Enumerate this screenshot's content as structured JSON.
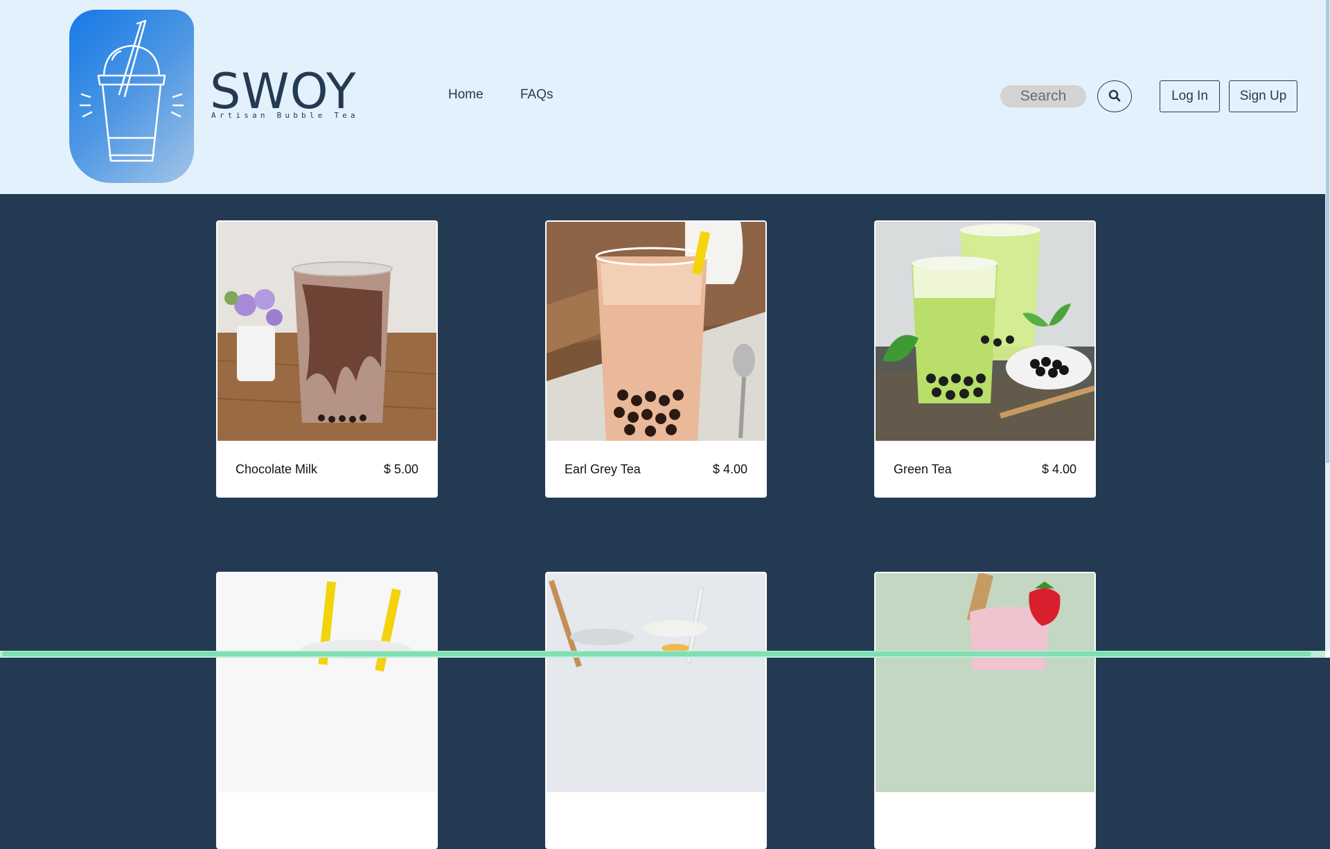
{
  "colors": {
    "header_bg": "#e3f1fc",
    "page_bg": "#243a53",
    "text_dark": "#243a53"
  },
  "brand": {
    "name": "SWOY",
    "tagline": "Artisan Bubble Tea",
    "logo_icon": "bubble-tea-cup-icon"
  },
  "nav": {
    "items": [
      {
        "label": "Home"
      },
      {
        "label": "FAQs"
      }
    ]
  },
  "search": {
    "placeholder": "Search",
    "icon": "search-icon"
  },
  "auth": {
    "login_label": "Log In",
    "signup_label": "Sign Up"
  },
  "products": [
    {
      "name": "Chocolate Milk",
      "price": "$ 5.00"
    },
    {
      "name": "Earl Grey Tea",
      "price": "$ 4.00"
    },
    {
      "name": "Green Tea",
      "price": "$ 4.00"
    },
    {
      "name": "",
      "price": ""
    },
    {
      "name": "",
      "price": ""
    },
    {
      "name": "",
      "price": ""
    }
  ]
}
